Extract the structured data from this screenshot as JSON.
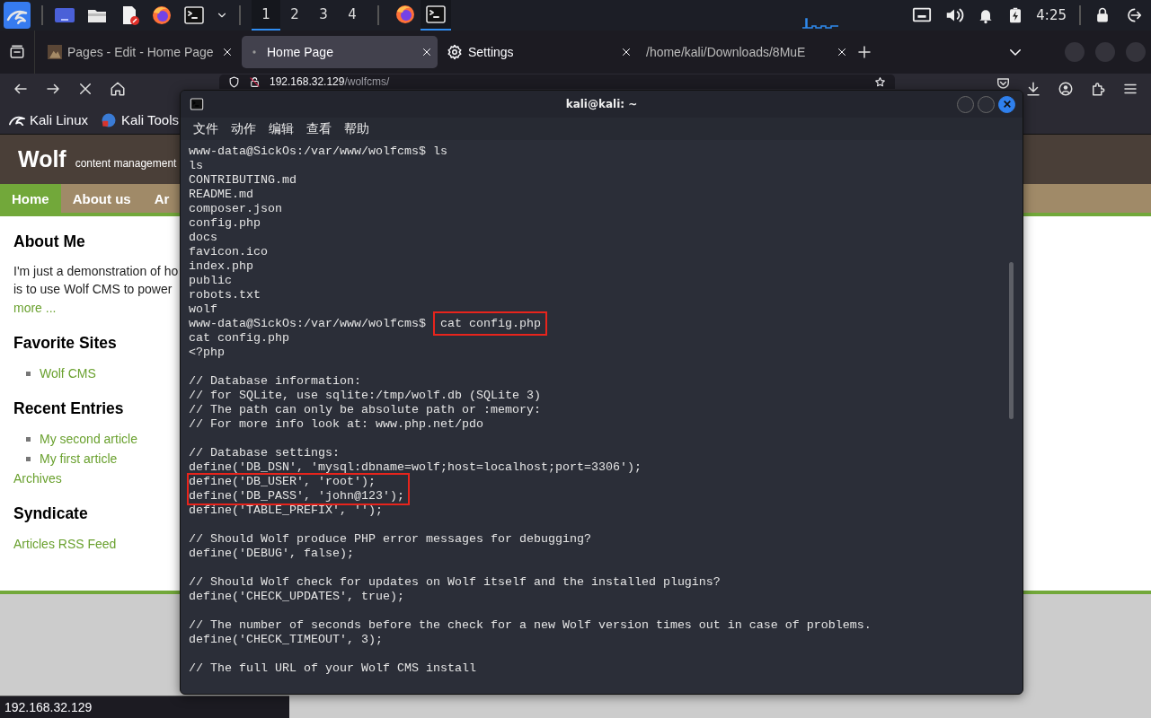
{
  "taskbar": {
    "workspaces": [
      {
        "label": "1",
        "selected": true
      },
      {
        "label": "2",
        "selected": false
      },
      {
        "label": "3",
        "selected": false
      },
      {
        "label": "4",
        "selected": false
      }
    ],
    "apps": [
      {
        "kind": "browser",
        "selected": false
      },
      {
        "kind": "terminal",
        "selected": true
      }
    ],
    "clock": "4:25"
  },
  "browser": {
    "tabs": [
      {
        "title": "Pages - Edit - Home Page",
        "kind": "page",
        "selected": false
      },
      {
        "title": "Home Page",
        "kind": "loading",
        "selected": true
      },
      {
        "title": "Settings",
        "kind": "settings",
        "selected": false
      },
      {
        "title": "/home/kali/Downloads/8MuE",
        "kind": "file",
        "selected": false
      }
    ],
    "url_host": "192.168.32.129",
    "url_path": "/wolfcms/",
    "bookmarks": [
      {
        "label": "Kali Linux",
        "kind": "dragon"
      },
      {
        "label": "Kali Tools",
        "kind": "tools"
      }
    ],
    "status": "192.168.32.129"
  },
  "website": {
    "title": "Wolf",
    "tagline": "content management",
    "nav": [
      {
        "label": "Home",
        "selected": true
      },
      {
        "label": "About us",
        "selected": false
      },
      {
        "label": "Ar",
        "selected": false
      }
    ],
    "sections": [
      {
        "heading": "About Me",
        "items": [
          {
            "kind": "text",
            "text": "I'm just a demonstration of ho"
          },
          {
            "kind": "text",
            "text": "is to use Wolf CMS to power"
          },
          {
            "kind": "link",
            "text": "more ..."
          }
        ]
      },
      {
        "heading": "Favorite Sites",
        "items": [
          {
            "kind": "bullet",
            "text": "Wolf CMS"
          }
        ]
      },
      {
        "heading": "Recent Entries",
        "items": [
          {
            "kind": "bullet",
            "text": "My second article"
          },
          {
            "kind": "bullet",
            "text": "My first article"
          },
          {
            "kind": "link",
            "text": "Archives"
          }
        ]
      },
      {
        "heading": "Syndicate",
        "items": [
          {
            "kind": "link",
            "text": "Articles RSS Feed"
          }
        ]
      }
    ]
  },
  "terminal": {
    "title": "kali@kali: ~",
    "menu": [
      "文件",
      "动作",
      "编辑",
      "查看",
      "帮助"
    ],
    "lines": [
      {
        "kind": "prompt",
        "prompt": "www-data@SickOs:/var/www/wolfcms$",
        "command": "ls",
        "boxed": false
      },
      {
        "kind": "output",
        "text": "ls",
        "boxed": false
      },
      {
        "kind": "output",
        "text": "CONTRIBUTING.md",
        "boxed": false
      },
      {
        "kind": "output",
        "text": "README.md",
        "boxed": false
      },
      {
        "kind": "output",
        "text": "composer.json",
        "boxed": false
      },
      {
        "kind": "output",
        "text": "config.php",
        "boxed": false
      },
      {
        "kind": "output",
        "text": "docs",
        "boxed": false
      },
      {
        "kind": "output",
        "text": "favicon.ico",
        "boxed": false
      },
      {
        "kind": "output",
        "text": "index.php",
        "boxed": false
      },
      {
        "kind": "output",
        "text": "public",
        "boxed": false
      },
      {
        "kind": "output",
        "text": "robots.txt",
        "boxed": false
      },
      {
        "kind": "output",
        "text": "wolf",
        "boxed": false
      },
      {
        "kind": "prompt",
        "prompt": "www-data@SickOs:/var/www/wolfcms$",
        "command": "cat config.php",
        "boxed": true
      },
      {
        "kind": "output",
        "text": "cat config.php",
        "boxed": false
      },
      {
        "kind": "output",
        "text": "<?php",
        "boxed": false
      },
      {
        "kind": "blank"
      },
      {
        "kind": "output",
        "text": "// Database information:",
        "boxed": false
      },
      {
        "kind": "output",
        "text": "// for SQLite, use sqlite:/tmp/wolf.db (SQLite 3)",
        "boxed": false
      },
      {
        "kind": "output",
        "text": "// The path can only be absolute path or :memory:",
        "boxed": false
      },
      {
        "kind": "output",
        "text": "// For more info look at: www.php.net/pdo",
        "boxed": false
      },
      {
        "kind": "blank"
      },
      {
        "kind": "output",
        "text": "// Database settings:",
        "boxed": false
      },
      {
        "kind": "output",
        "text": "define('DB_DSN', 'mysql:dbname=wolf;host=localhost;port=3306');",
        "boxed": false
      },
      {
        "kind": "output",
        "text": "define('DB_USER', 'root');",
        "boxed": true
      },
      {
        "kind": "output",
        "text": "define('DB_PASS', 'john@123');",
        "boxed": true
      },
      {
        "kind": "output",
        "text": "define('TABLE_PREFIX', '');",
        "boxed": false
      },
      {
        "kind": "blank"
      },
      {
        "kind": "output",
        "text": "// Should Wolf produce PHP error messages for debugging?",
        "boxed": false
      },
      {
        "kind": "output",
        "text": "define('DEBUG', false);",
        "boxed": false
      },
      {
        "kind": "blank"
      },
      {
        "kind": "output",
        "text": "// Should Wolf check for updates on Wolf itself and the installed plugins?",
        "boxed": false
      },
      {
        "kind": "output",
        "text": "define('CHECK_UPDATES', true);",
        "boxed": false
      },
      {
        "kind": "blank"
      },
      {
        "kind": "output",
        "text": "// The number of seconds before the check for a new Wolf version times out in case of problems.",
        "boxed": false
      },
      {
        "kind": "output",
        "text": "define('CHECK_TIMEOUT', 3);",
        "boxed": false
      },
      {
        "kind": "blank"
      },
      {
        "kind": "output",
        "text": "// The full URL of your Wolf CMS install",
        "boxed": false
      }
    ]
  }
}
